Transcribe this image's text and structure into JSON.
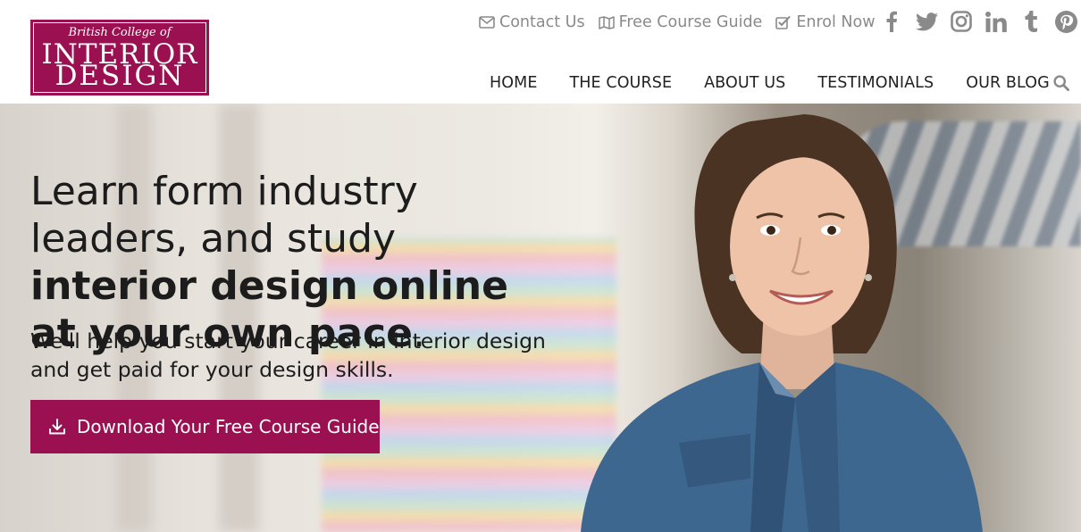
{
  "logo": {
    "line1": "British College of",
    "line2": "INTERIOR",
    "line3": "DESIGN"
  },
  "toplinks": [
    {
      "label": "Contact Us",
      "icon": "envelope-icon"
    },
    {
      "label": "Free Course Guide",
      "icon": "book-icon"
    },
    {
      "label": "Enrol Now",
      "icon": "checkbox-icon"
    }
  ],
  "social": [
    "facebook-icon",
    "twitter-icon",
    "instagram-icon",
    "linkedin-icon",
    "tumblr-icon",
    "pinterest-icon"
  ],
  "nav": {
    "items": [
      "HOME",
      "THE COURSE",
      "ABOUT US",
      "TESTIMONIALS",
      "OUR BLOG"
    ],
    "search_icon": "search-icon"
  },
  "hero": {
    "title_part1": "Learn form industry leaders, and study ",
    "title_bold": "interior design online at your own pace",
    "title_end": ".",
    "subtitle": "We'll help you start your career in interior design and get paid for your design skills.",
    "cta_label": "Download Your Free Course Guide",
    "cta_icon": "download-icon"
  },
  "colors": {
    "brand": "#9a1050",
    "toplink_gray": "#8a8a8a",
    "nav_text": "#222222"
  }
}
